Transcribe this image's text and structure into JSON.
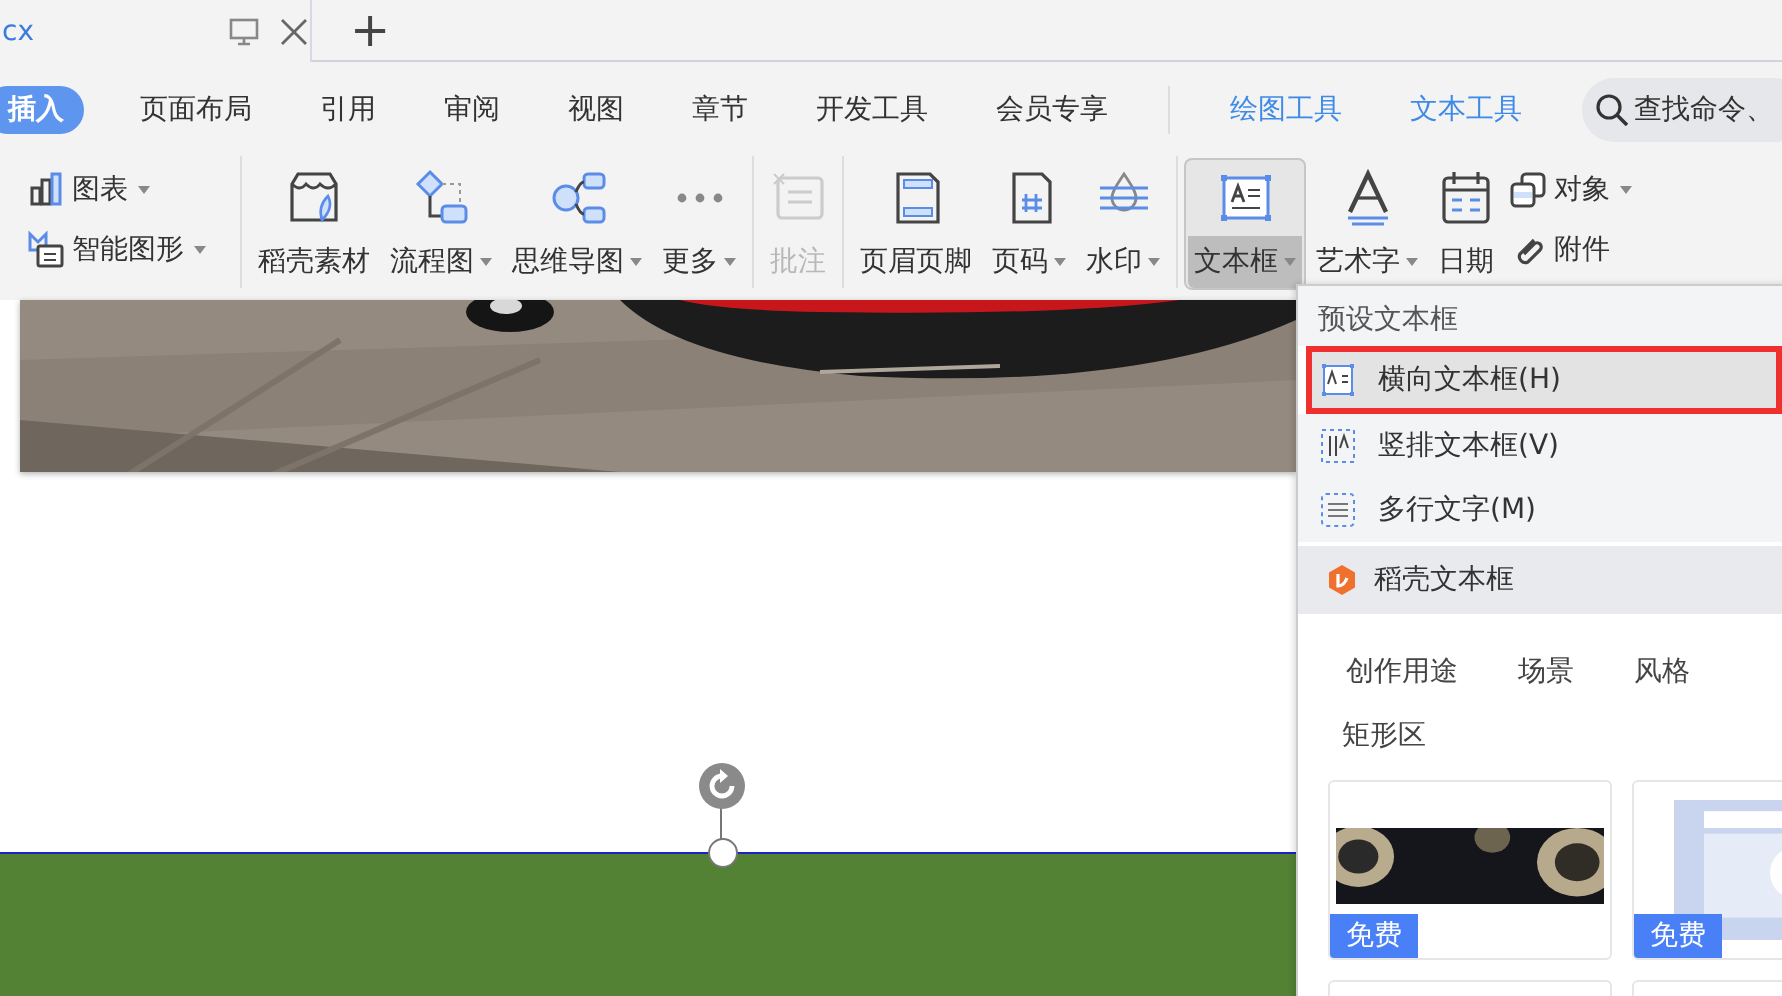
{
  "title_bar": {
    "document_tab": "cx",
    "new_tab": "+"
  },
  "ribbon_tabs": [
    {
      "label": "插入",
      "selected": true,
      "kind": "main"
    },
    {
      "label": "页面布局",
      "selected": false,
      "kind": "main"
    },
    {
      "label": "引用",
      "selected": false,
      "kind": "main"
    },
    {
      "label": "审阅",
      "selected": false,
      "kind": "main"
    },
    {
      "label": "视图",
      "selected": false,
      "kind": "main"
    },
    {
      "label": "章节",
      "selected": false,
      "kind": "main"
    },
    {
      "label": "开发工具",
      "selected": false,
      "kind": "main"
    },
    {
      "label": "会员专享",
      "selected": false,
      "kind": "main"
    },
    {
      "label": "绘图工具",
      "selected": false,
      "kind": "context"
    },
    {
      "label": "文本工具",
      "selected": false,
      "kind": "context"
    }
  ],
  "search": {
    "placeholder": "查找命令、"
  },
  "toolbar": {
    "groups": [
      {
        "items": [
          {
            "label": "图表",
            "kind": "small",
            "caret": true,
            "disabled": false,
            "selected": false
          },
          {
            "label": "智能图形",
            "kind": "small",
            "caret": true,
            "disabled": false,
            "selected": false
          }
        ]
      },
      {
        "items": [
          {
            "label": "稻壳素材",
            "kind": "large",
            "caret": false,
            "disabled": false,
            "selected": false
          },
          {
            "label": "流程图",
            "kind": "large",
            "caret": true,
            "disabled": false,
            "selected": false
          },
          {
            "label": "思维导图",
            "kind": "large",
            "caret": true,
            "disabled": false,
            "selected": false
          },
          {
            "label": "更多",
            "kind": "large",
            "caret": true,
            "disabled": false,
            "selected": false
          }
        ]
      },
      {
        "items": [
          {
            "label": "批注",
            "kind": "large",
            "caret": false,
            "disabled": true,
            "selected": false
          }
        ]
      },
      {
        "items": [
          {
            "label": "页眉页脚",
            "kind": "large",
            "caret": false,
            "disabled": false,
            "selected": false
          },
          {
            "label": "页码",
            "kind": "large",
            "caret": true,
            "disabled": false,
            "selected": false
          },
          {
            "label": "水印",
            "kind": "large",
            "caret": true,
            "disabled": false,
            "selected": false
          }
        ]
      },
      {
        "items": [
          {
            "label": "文本框",
            "kind": "large",
            "caret": true,
            "disabled": false,
            "selected": true
          },
          {
            "label": "艺术字",
            "kind": "large",
            "caret": true,
            "disabled": false,
            "selected": false
          },
          {
            "label": "日期",
            "kind": "large",
            "caret": false,
            "disabled": false,
            "selected": false
          },
          {
            "label": "对象",
            "kind": "small",
            "caret": true,
            "disabled": false,
            "selected": false
          },
          {
            "label": "附件",
            "kind": "small",
            "caret": false,
            "disabled": false,
            "selected": false
          }
        ]
      }
    ]
  },
  "dropdown": {
    "header": "预设文本框",
    "items": [
      {
        "label": "横向文本框(H)",
        "selected": true
      },
      {
        "label": "竖排文本框(V)",
        "selected": false
      },
      {
        "label": "多行文字(M)",
        "selected": false
      }
    ],
    "section": "稻壳文本框",
    "filters": [
      "创作用途",
      "场景",
      "风格"
    ],
    "category": "矩形区",
    "cards": [
      {
        "kind": "picture",
        "badge": "免费"
      },
      {
        "kind": "picture",
        "badge": "免费"
      },
      {
        "kind": "blank"
      },
      {
        "kind": "blank"
      }
    ]
  }
}
